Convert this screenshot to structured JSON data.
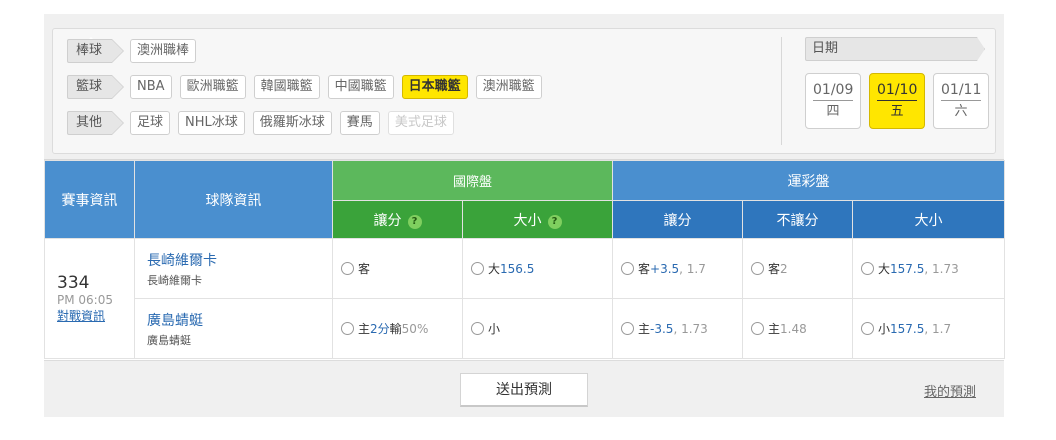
{
  "categories": [
    {
      "label": "棒球",
      "leagues": [
        {
          "name": "澳洲職棒",
          "state": "normal"
        }
      ]
    },
    {
      "label": "籃球",
      "leagues": [
        {
          "name": "NBA",
          "state": "normal"
        },
        {
          "name": "歐洲職籃",
          "state": "normal"
        },
        {
          "name": "韓國職籃",
          "state": "normal"
        },
        {
          "name": "中國職籃",
          "state": "normal"
        },
        {
          "name": "日本職籃",
          "state": "active"
        },
        {
          "name": "澳洲職籃",
          "state": "normal"
        }
      ]
    },
    {
      "label": "其他",
      "leagues": [
        {
          "name": "足球",
          "state": "normal"
        },
        {
          "name": "NHL冰球",
          "state": "normal"
        },
        {
          "name": "俄羅斯冰球",
          "state": "normal"
        },
        {
          "name": "賽馬",
          "state": "normal"
        },
        {
          "name": "美式足球",
          "state": "disabled"
        }
      ]
    }
  ],
  "date_section": {
    "label": "日期",
    "dates": [
      {
        "date": "01/09",
        "weekday": "四",
        "active": false
      },
      {
        "date": "01/10",
        "weekday": "五",
        "active": true
      },
      {
        "date": "01/11",
        "weekday": "六",
        "active": false
      }
    ]
  },
  "table": {
    "col_game": "賽事資訊",
    "col_team": "球隊資訊",
    "group_intl": "國際盤",
    "group_sports": "運彩盤",
    "sub_handicap": "讓分",
    "sub_total": "大小",
    "sub_no_handicap": "不讓分",
    "help_glyph": "?",
    "game": {
      "number": "334",
      "time": "PM 06:05",
      "link": "對戰資訊"
    },
    "rows": [
      {
        "team": "長崎維爾卡",
        "team_sub": "長崎維爾卡",
        "intl_handicap": {
          "text": "客",
          "value": "",
          "odds": ""
        },
        "intl_total": {
          "text": "大",
          "value": "156.5",
          "odds": ""
        },
        "sports_handicap": {
          "text": "客",
          "value": "+3.5",
          "odds": ", 1.7"
        },
        "sports_nohandicap": {
          "text": "客",
          "value": "",
          "odds": "2"
        },
        "sports_total": {
          "text": "大",
          "value": "157.5",
          "odds": ", 1.73"
        }
      },
      {
        "team": "廣島蜻蜓",
        "team_sub": "廣島蜻蜓",
        "intl_handicap": {
          "text": "主",
          "value": "2分",
          "extra": "輸",
          "odds": "50%"
        },
        "intl_total": {
          "text": "小",
          "value": "",
          "odds": ""
        },
        "sports_handicap": {
          "text": "主",
          "value": "-3.5",
          "odds": ", 1.73"
        },
        "sports_nohandicap": {
          "text": "主",
          "value": "",
          "odds": "1.48"
        },
        "sports_total": {
          "text": "小",
          "value": "157.5",
          "odds": ", 1.7"
        }
      }
    ]
  },
  "footer": {
    "submit": "送出預測",
    "my_predictions": "我的預測"
  },
  "colors": {
    "accent_yellow": "#ffe600",
    "header_blue": "#4a8fcf",
    "header_green": "#5cb85c",
    "link_blue": "#2a6ab1"
  }
}
